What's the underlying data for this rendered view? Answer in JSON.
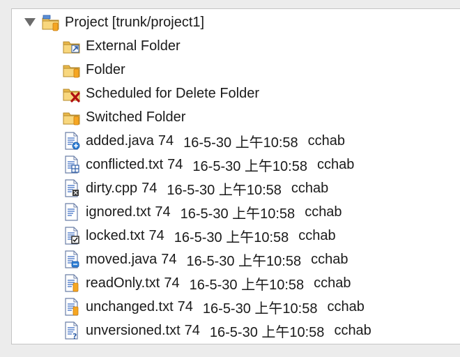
{
  "tree": {
    "root": {
      "label": "Project [trunk/project1]",
      "expanded": true,
      "icon": "project-folder-icon"
    },
    "folders": [
      {
        "label": "External Folder",
        "icon": "external-folder-icon",
        "overlay": "external"
      },
      {
        "label": "Folder",
        "icon": "folder-icon",
        "overlay": "versioned"
      },
      {
        "label": "Scheduled for Delete Folder",
        "icon": "delete-folder-icon",
        "overlay": "delete"
      },
      {
        "label": "Switched Folder",
        "icon": "switched-folder-icon",
        "overlay": "versioned"
      }
    ],
    "files": [
      {
        "name": "added.java",
        "revision": "74",
        "date": "16-5-30 上午10:58",
        "author": "cchab",
        "overlay": "added"
      },
      {
        "name": "conflicted.txt",
        "revision": "74",
        "date": "16-5-30 上午10:58",
        "author": "cchab",
        "overlay": "conflicted"
      },
      {
        "name": "dirty.cpp",
        "revision": "74",
        "date": "16-5-30 上午10:58",
        "author": "cchab",
        "overlay": "dirty"
      },
      {
        "name": "ignored.txt",
        "revision": "74",
        "date": "16-5-30 上午10:58",
        "author": "cchab",
        "overlay": "none"
      },
      {
        "name": "locked.txt",
        "revision": "74",
        "date": "16-5-30 上午10:58",
        "author": "cchab",
        "overlay": "locked"
      },
      {
        "name": "moved.java",
        "revision": "74",
        "date": "16-5-30 上午10:58",
        "author": "cchab",
        "overlay": "moved"
      },
      {
        "name": "readOnly.txt",
        "revision": "74",
        "date": "16-5-30 上午10:58",
        "author": "cchab",
        "overlay": "versioned"
      },
      {
        "name": "unchanged.txt",
        "revision": "74",
        "date": "16-5-30 上午10:58",
        "author": "cchab",
        "overlay": "versioned"
      },
      {
        "name": "unversioned.txt",
        "revision": "74",
        "date": "16-5-30 上午10:58",
        "author": "cchab",
        "overlay": "unversioned"
      }
    ]
  },
  "colors": {
    "folder": "#f2c35a",
    "versioned_overlay": "#f5a623",
    "file_lines": "#3b6cc4",
    "delete_overlay": "#b01010"
  }
}
